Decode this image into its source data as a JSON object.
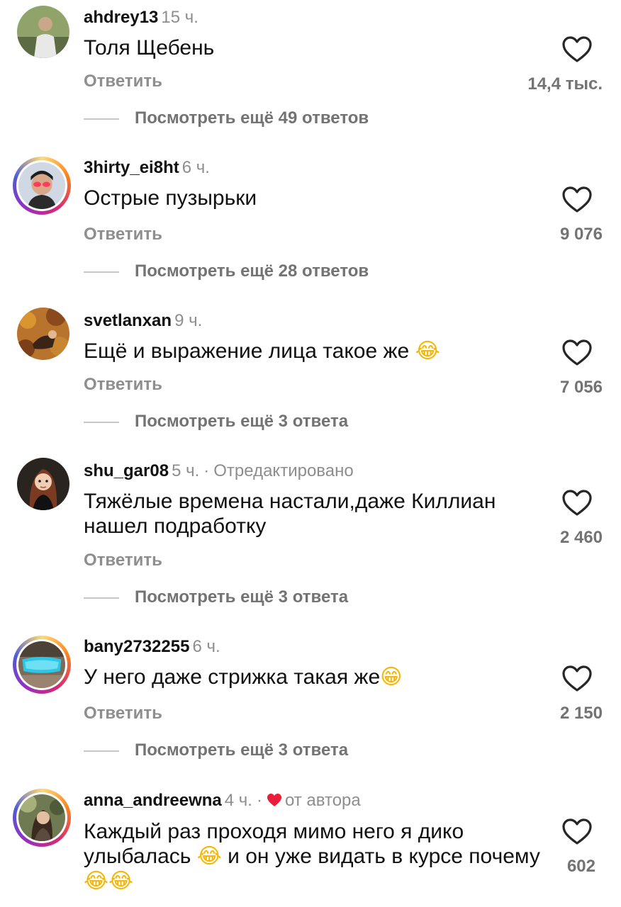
{
  "comments": [
    {
      "username": "ahdrey13",
      "time": "15 ч.",
      "text": "Толя Щебень",
      "reply": "Ответить",
      "likes": "14,4 тыс.",
      "more": "Посмотреть ещё 49 ответов",
      "story_ring": false
    },
    {
      "username": "3hirty_ei8ht",
      "time": "6 ч.",
      "text": "Острые пузырьки",
      "reply": "Ответить",
      "likes": "9 076",
      "more": "Посмотреть ещё 28 ответов",
      "story_ring": true
    },
    {
      "username": "svetlanxan",
      "time": "9 ч.",
      "text": "Ещё и выражение лица такое же",
      "emoji": "😂",
      "reply": "Ответить",
      "likes": "7 056",
      "more": "Посмотреть ещё 3 ответа",
      "story_ring": false
    },
    {
      "username": "shu_gar08",
      "time": "5 ч.",
      "separator": "·",
      "extra": "Отредактировано",
      "text": "Тяжёлые времена настали,даже Киллиан нашел подработку",
      "reply": "Ответить",
      "likes": "2 460",
      "more": "Посмотреть ещё 3 ответа",
      "story_ring": false
    },
    {
      "username": "bany2732255",
      "time": "6 ч.",
      "text": "У него даже стрижка такая же",
      "emoji": "😁",
      "reply": "Ответить",
      "likes": "2 150",
      "more": "Посмотреть ещё 3 ответа",
      "story_ring": true
    },
    {
      "username": "anna_andreewna",
      "time": "4 ч.",
      "separator": "·",
      "extra": "от автора",
      "text_part1": "Каждый раз проходя мимо него я дико улыбалась",
      "emoji1": "😂",
      "text_part2": " и он уже видать в курсе почему",
      "emoji2": "😂😂",
      "likes": "602",
      "story_ring": true
    }
  ],
  "colors": {
    "text": "#111111",
    "secondary": "#8e8e8e",
    "heart_red": "#ed1c3a"
  },
  "icons": {
    "like": "heart-outline-icon",
    "author_like": "heart-filled-icon"
  }
}
